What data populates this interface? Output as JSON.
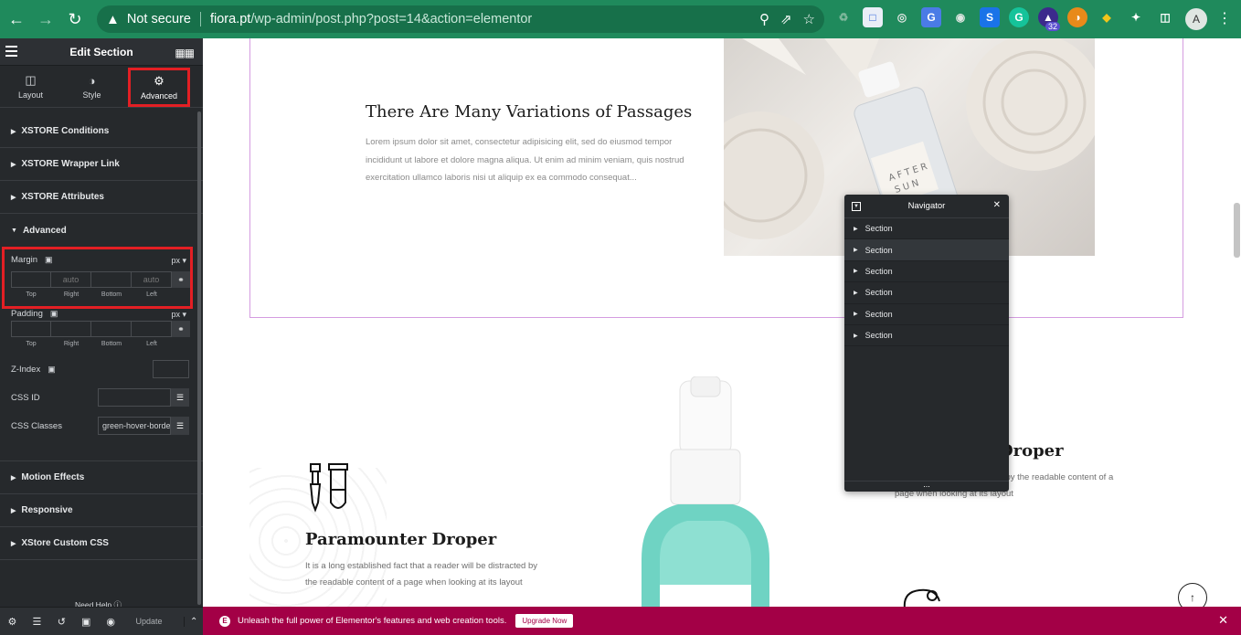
{
  "browser": {
    "security_label": "Not secure",
    "url_host": "fiora.pt",
    "url_path": "/wp-admin/post.php?post=14&action=elementor",
    "extension_badge": "32",
    "avatar_letter": "A"
  },
  "sidebar": {
    "title": "Edit Section",
    "tabs": [
      {
        "label": "Layout",
        "icon": "layout-icon"
      },
      {
        "label": "Style",
        "icon": "style-icon"
      },
      {
        "label": "Advanced",
        "icon": "gear-icon"
      }
    ],
    "active_tab": "Advanced",
    "sections_top": [
      "XSTORE Conditions",
      "XSTORE Wrapper Link",
      "XSTORE Attributes",
      "Advanced"
    ],
    "margin": {
      "label": "Margin",
      "unit": "px",
      "fields": [
        {
          "label": "Top",
          "value": "",
          "placeholder": ""
        },
        {
          "label": "Right",
          "value": "",
          "placeholder": "auto"
        },
        {
          "label": "Bottom",
          "value": "",
          "placeholder": ""
        },
        {
          "label": "Left",
          "value": "",
          "placeholder": "auto"
        }
      ]
    },
    "padding": {
      "label": "Padding",
      "unit": "px",
      "fields": [
        {
          "label": "Top",
          "value": ""
        },
        {
          "label": "Right",
          "value": ""
        },
        {
          "label": "Bottom",
          "value": ""
        },
        {
          "label": "Left",
          "value": ""
        }
      ]
    },
    "z_index": {
      "label": "Z-Index",
      "value": ""
    },
    "css_id": {
      "label": "CSS ID",
      "value": ""
    },
    "css_classes": {
      "label": "CSS Classes",
      "value": "green-hover-borde"
    },
    "sections_bottom": [
      "Motion Effects",
      "Responsive",
      "XStore Custom CSS"
    ],
    "need_help": "Need Help",
    "footer": {
      "update_label": "Update"
    }
  },
  "canvas": {
    "heading": "There Are Many Variations of Passages",
    "paragraph": "Lorem ipsum dolor sit amet, consectetur adipisicing elit, sed do eiusmod tempor incididunt ut labore et dolore magna aliqua. Ut enim ad minim veniam, quis nostrud exercitation ullamco laboris nisi ut aliquip ex ea commodo consequat...",
    "bottle_label": "AFTER SUN",
    "left_feature": {
      "title": "Paramounter Droper",
      "text": "It is a long established fact that a reader will be distracted by the readable content of a page when looking at its layout"
    },
    "right_feature": {
      "title": "Droper",
      "text": "at a reader will be distracted by the readable content of a page when looking at its layout"
    }
  },
  "navigator": {
    "title": "Navigator",
    "items": [
      "Section",
      "Section",
      "Section",
      "Section",
      "Section",
      "Section"
    ]
  },
  "promo": {
    "text": "Unleash the full power of Elementor's features and web creation tools.",
    "button": "Upgrade Now"
  },
  "colors": {
    "chrome": "#1f8a5c",
    "sidebar": "#26292c",
    "highlight": "#e31f24",
    "promo": "#a30046"
  }
}
